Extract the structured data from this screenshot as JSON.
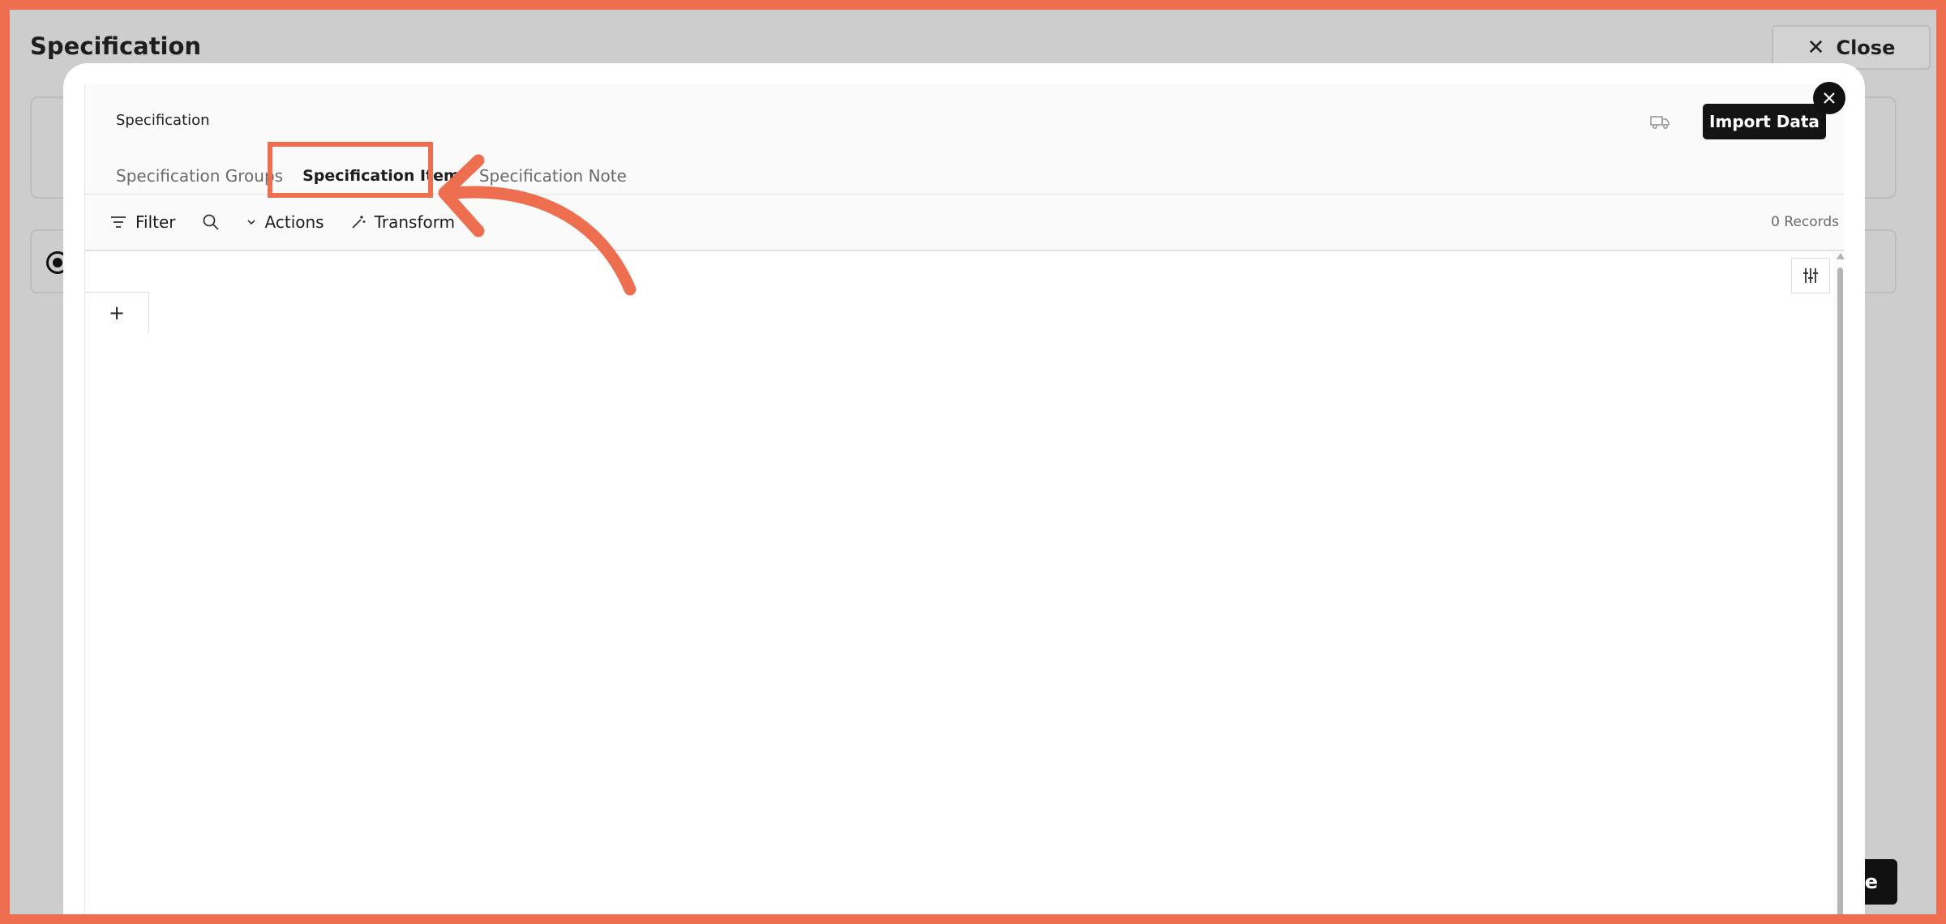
{
  "background": {
    "page_title": "Specification",
    "close_label": "Close",
    "save_label": "e"
  },
  "modal": {
    "title": "Specification",
    "import_label": "Import Data",
    "tabs": [
      {
        "label": "Specification Groups",
        "active": false
      },
      {
        "label": "Specification Item",
        "active": true
      },
      {
        "label": "Specification Note",
        "active": false
      }
    ],
    "toolbar": {
      "filter_label": "Filter",
      "actions_label": "Actions",
      "transform_label": "Transform"
    },
    "records_label": "0 Records",
    "add_column_label": "+"
  },
  "icons": {
    "truck": "truck-icon",
    "close": "close-icon",
    "filter": "filter-icon",
    "search": "search-icon",
    "chevron": "chevron-down-icon",
    "wand": "magic-wand-icon",
    "settings": "sliders-icon"
  },
  "colors": {
    "annotation": "#ee6e50",
    "primary_button": "#141414"
  }
}
